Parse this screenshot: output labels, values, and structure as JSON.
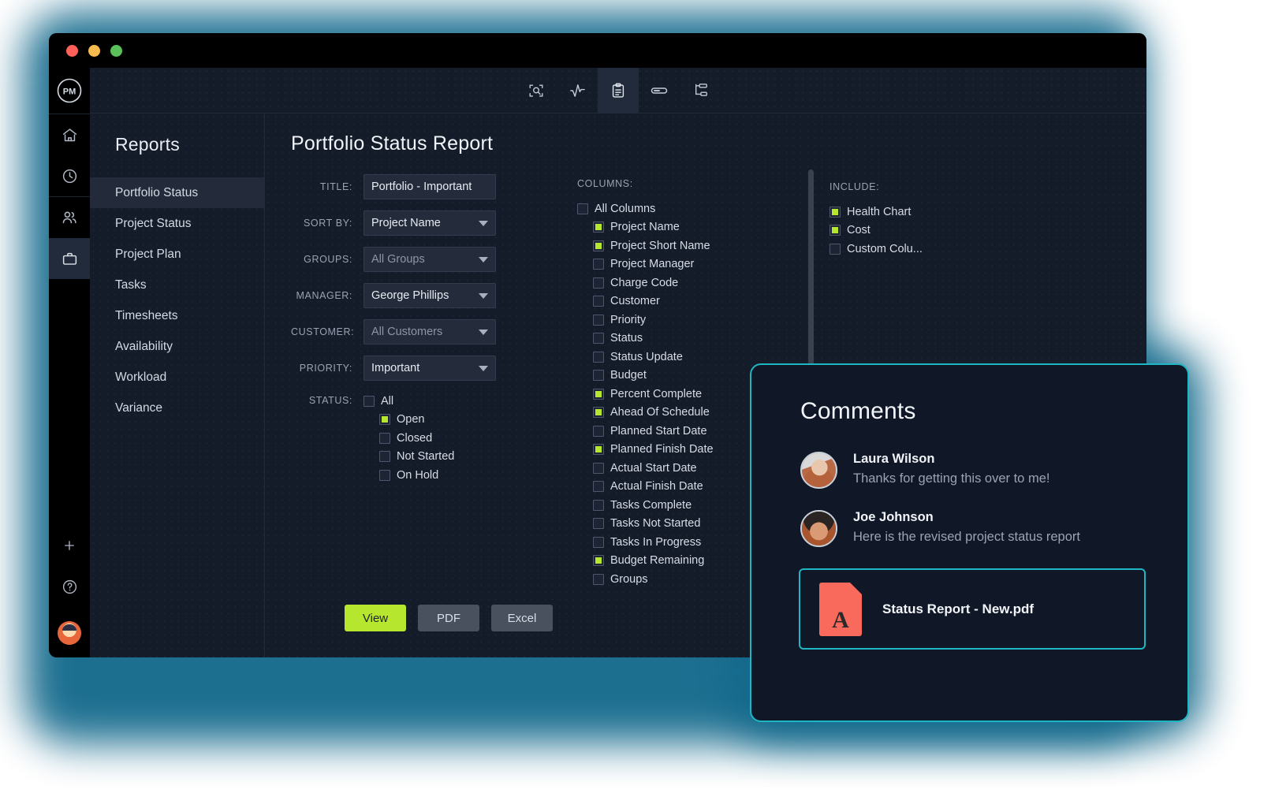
{
  "window": {
    "traffic_lights": [
      "close",
      "minimize",
      "maximize"
    ],
    "logo_text": "PM"
  },
  "rail": {
    "items": [
      {
        "icon": "home-icon",
        "label": "Home",
        "active": false
      },
      {
        "icon": "clock-icon",
        "label": "Time",
        "active": false
      },
      {
        "icon": "people-icon",
        "label": "Team",
        "active": false
      },
      {
        "icon": "briefcase-icon",
        "label": "Portfolio",
        "active": true
      }
    ],
    "bottom": [
      {
        "icon": "plus-icon",
        "label": "Add"
      },
      {
        "icon": "help-icon",
        "label": "Help"
      },
      {
        "icon": "user-avatar",
        "label": "Account"
      }
    ]
  },
  "toolbar": {
    "items": [
      {
        "icon": "scan-search-icon",
        "label": "Search",
        "active": false
      },
      {
        "icon": "activity-chart-icon",
        "label": "Activity",
        "active": false
      },
      {
        "icon": "clipboard-icon",
        "label": "Reports",
        "active": true
      },
      {
        "icon": "progress-bar-icon",
        "label": "Progress",
        "active": false
      },
      {
        "icon": "hierarchy-icon",
        "label": "Structure",
        "active": false
      }
    ]
  },
  "reports_pane": {
    "title": "Reports",
    "items": [
      {
        "label": "Portfolio Status",
        "selected": true
      },
      {
        "label": "Project Status",
        "selected": false
      },
      {
        "label": "Project Plan",
        "selected": false
      },
      {
        "label": "Tasks",
        "selected": false
      },
      {
        "label": "Timesheets",
        "selected": false
      },
      {
        "label": "Availability",
        "selected": false
      },
      {
        "label": "Workload",
        "selected": false
      },
      {
        "label": "Variance",
        "selected": false
      }
    ]
  },
  "main": {
    "page_title": "Portfolio Status Report",
    "form": {
      "title": {
        "label": "TITLE:",
        "value": "Portfolio - Important",
        "type": "text"
      },
      "sort_by": {
        "label": "SORT BY:",
        "value": "Project Name",
        "type": "select",
        "muted": false
      },
      "groups": {
        "label": "GROUPS:",
        "value": "All Groups",
        "type": "select",
        "muted": true
      },
      "manager": {
        "label": "MANAGER:",
        "value": "George Phillips",
        "type": "select",
        "muted": false
      },
      "customer": {
        "label": "CUSTOMER:",
        "value": "All Customers",
        "type": "select",
        "muted": true
      },
      "priority": {
        "label": "PRIORITY:",
        "value": "Important",
        "type": "select",
        "muted": false
      },
      "status": {
        "label": "STATUS:",
        "options": [
          {
            "label": "All",
            "checked": false,
            "indent": false
          },
          {
            "label": "Open",
            "checked": true,
            "indent": true
          },
          {
            "label": "Closed",
            "checked": false,
            "indent": true
          },
          {
            "label": "Not Started",
            "checked": false,
            "indent": true
          },
          {
            "label": "On Hold",
            "checked": false,
            "indent": true
          }
        ]
      }
    },
    "columns": {
      "label": "COLUMNS:",
      "options": [
        {
          "label": "All Columns",
          "checked": false,
          "indent": false
        },
        {
          "label": "Project Name",
          "checked": true,
          "indent": true
        },
        {
          "label": "Project Short Name",
          "checked": true,
          "indent": true
        },
        {
          "label": "Project Manager",
          "checked": false,
          "indent": true
        },
        {
          "label": "Charge Code",
          "checked": false,
          "indent": true
        },
        {
          "label": "Customer",
          "checked": false,
          "indent": true
        },
        {
          "label": "Priority",
          "checked": false,
          "indent": true
        },
        {
          "label": "Status",
          "checked": false,
          "indent": true
        },
        {
          "label": "Status Update",
          "checked": false,
          "indent": true
        },
        {
          "label": "Budget",
          "checked": false,
          "indent": true
        },
        {
          "label": "Percent Complete",
          "checked": true,
          "indent": true
        },
        {
          "label": "Ahead Of Schedule",
          "checked": true,
          "indent": true
        },
        {
          "label": "Planned Start Date",
          "checked": false,
          "indent": true
        },
        {
          "label": "Planned Finish Date",
          "checked": true,
          "indent": true
        },
        {
          "label": "Actual Start Date",
          "checked": false,
          "indent": true
        },
        {
          "label": "Actual Finish Date",
          "checked": false,
          "indent": true
        },
        {
          "label": "Tasks Complete",
          "checked": false,
          "indent": true
        },
        {
          "label": "Tasks Not Started",
          "checked": false,
          "indent": true
        },
        {
          "label": "Tasks In Progress",
          "checked": false,
          "indent": true
        },
        {
          "label": "Budget Remaining",
          "checked": true,
          "indent": true
        },
        {
          "label": "Groups",
          "checked": false,
          "indent": true
        }
      ]
    },
    "include": {
      "label": "INCLUDE:",
      "options": [
        {
          "label": "Health Chart",
          "checked": true
        },
        {
          "label": "Cost",
          "checked": true
        },
        {
          "label": "Custom Colu...",
          "checked": false
        }
      ]
    },
    "actions": [
      {
        "label": "View",
        "primary": true
      },
      {
        "label": "PDF",
        "primary": false
      },
      {
        "label": "Excel",
        "primary": false
      }
    ]
  },
  "comments": {
    "title": "Comments",
    "entries": [
      {
        "author": "Laura Wilson",
        "text": "Thanks for getting this over to me!",
        "avatar": "laura"
      },
      {
        "author": "Joe Johnson",
        "text": "Here is the revised project status report",
        "avatar": "joe"
      }
    ],
    "attachment": {
      "name": "Status Report - New.pdf",
      "icon": "pdf-file-icon",
      "glyph": "A"
    }
  },
  "colors": {
    "accent_green": "#b7e62e",
    "accent_cyan": "#1fb6c4",
    "glow_teal": "#11688b",
    "panel_bg": "#141b29",
    "window_bg": "#000000",
    "pdf_red": "#f96a5d"
  }
}
